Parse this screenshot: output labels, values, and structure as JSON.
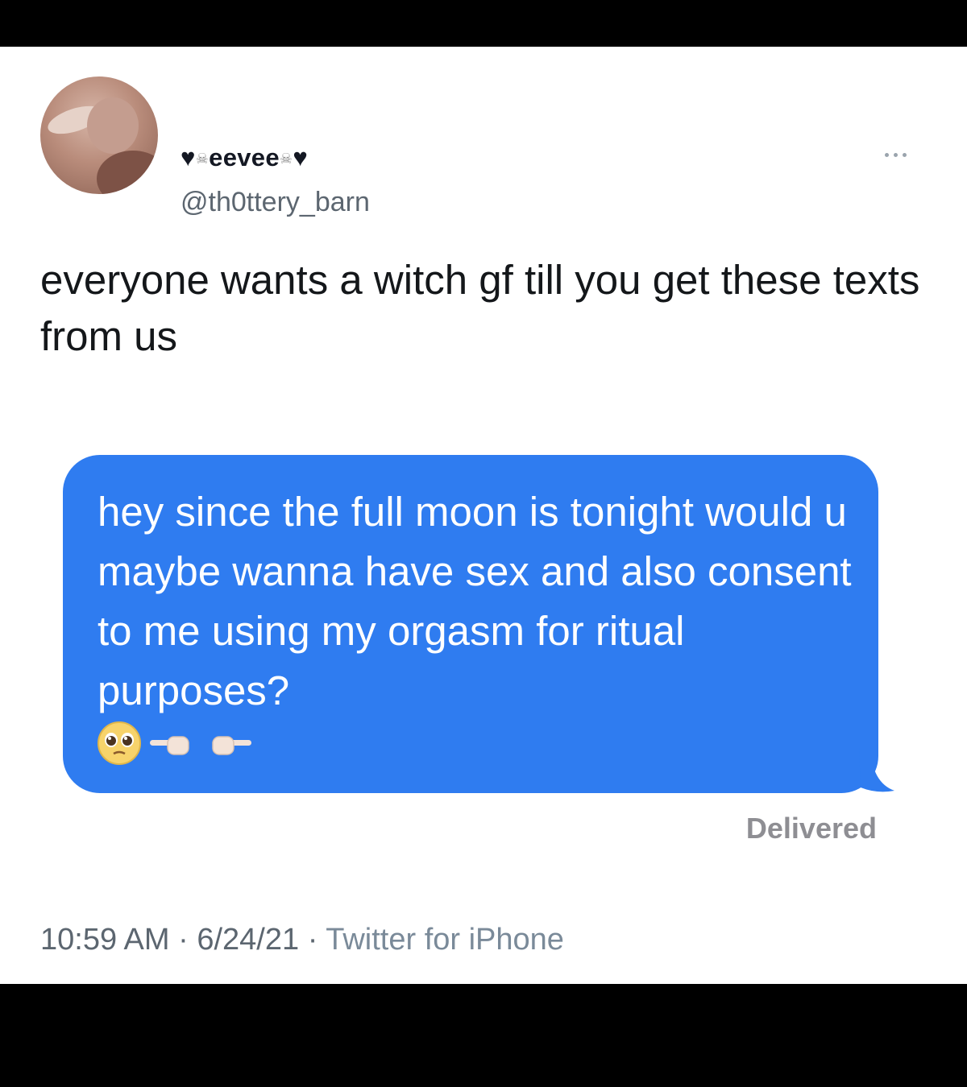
{
  "author": {
    "display_name": "eevee",
    "display_name_prefix": "♥",
    "display_name_suffix": "♥",
    "skull_glyph": "☠",
    "handle": "@th0ttery_barn"
  },
  "tweet": {
    "text": "everyone wants a witch gf till you get these texts from us"
  },
  "message": {
    "text": "hey since the full moon is tonight would u maybe wanna have sex and also consent to me using my orgasm for ritual purposes?",
    "emojis": [
      "pleading-face",
      "pointing-finger-left",
      "pointing-finger-right"
    ],
    "status": "Delivered",
    "bubble_color": "#2f7cf0"
  },
  "meta": {
    "time": "10:59 AM",
    "separator": "·",
    "date": "6/24/21",
    "source": "Twitter for iPhone"
  },
  "colors": {
    "background": "#000000",
    "card": "#ffffff",
    "text": "#14171a",
    "secondary": "#5c6670"
  }
}
